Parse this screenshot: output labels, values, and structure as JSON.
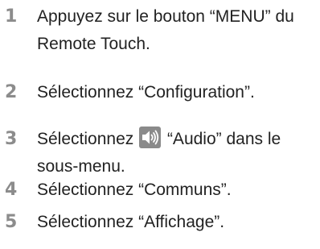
{
  "steps": [
    {
      "number": "1",
      "line1": "Appuyez sur le bouton “MENU” du",
      "line2": "Remote Touch."
    },
    {
      "number": "2",
      "line1": "Sélectionnez “Configuration”."
    },
    {
      "number": "3",
      "line1_before": "Sélectionnez",
      "line1_after": "“Audio” dans le",
      "line2": "sous-menu.",
      "icon": "speaker-audio-icon",
      "icon_colors": {
        "background": "#8a8a8a",
        "glyph": "#ffffff"
      }
    },
    {
      "number": "4",
      "line1": "Sélectionnez “Communs”."
    },
    {
      "number": "5",
      "line1": "Sélectionnez “Affichage”."
    }
  ],
  "colors": {
    "step_number": "#8c8c8c",
    "text": "#222222"
  }
}
